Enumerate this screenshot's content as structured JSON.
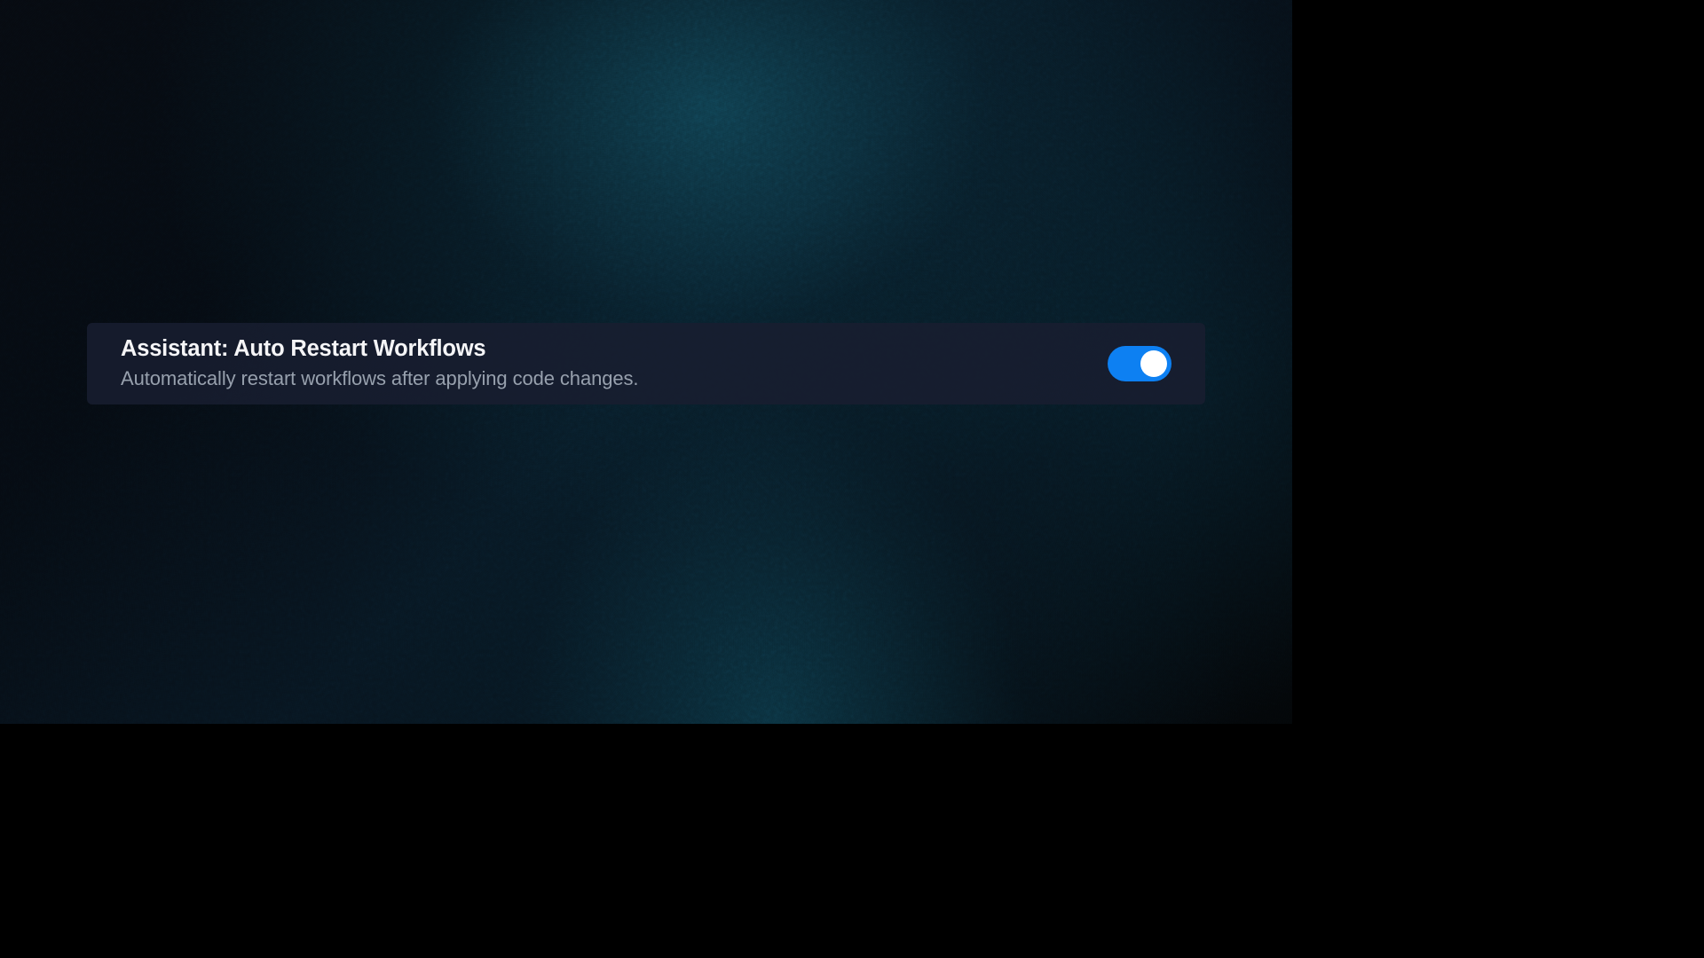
{
  "setting": {
    "title": "Assistant: Auto Restart Workflows",
    "description": "Automatically restart workflows after applying code changes.",
    "toggle_state": "on"
  },
  "colors": {
    "panel_bg": "#181e30",
    "title_text": "#f5f5f7",
    "description_text": "#97a0ad",
    "toggle_active": "#0d80f2",
    "toggle_knob": "#ffffff"
  }
}
